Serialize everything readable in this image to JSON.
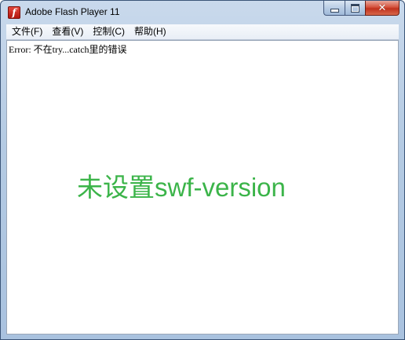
{
  "window": {
    "title": "Adobe Flash Player 11",
    "icon": "flash-player-icon",
    "icon_glyph": "f",
    "controls": {
      "minimize_icon": "minimize-icon",
      "maximize_icon": "maximize-icon",
      "close_icon": "close-icon",
      "close_glyph": "✕"
    }
  },
  "menubar": {
    "items": [
      {
        "label": "文件(F)"
      },
      {
        "label": "查看(V)"
      },
      {
        "label": "控制(C)"
      },
      {
        "label": "帮助(H)"
      }
    ]
  },
  "content": {
    "error_message": "Error: 不在try...catch里的错误",
    "main_text": "未设置swf-version",
    "main_text_color": "#3bb449"
  }
}
